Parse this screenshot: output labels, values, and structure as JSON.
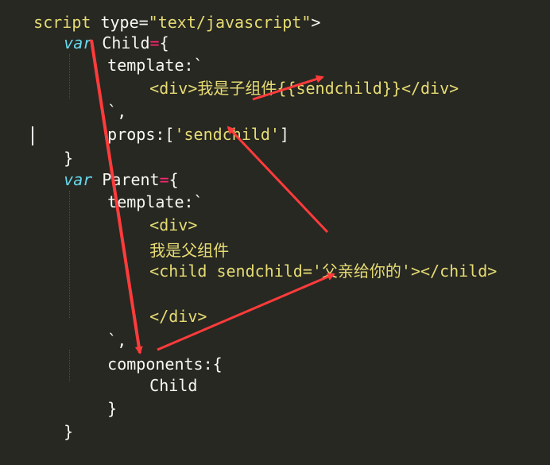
{
  "code": {
    "l0": {
      "a": "script",
      "b": " type=",
      "c": "\"text/javascript\"",
      "d": ">"
    },
    "l1": {
      "kw": "var",
      "name": " Child",
      "op": "=",
      "brace": "{"
    },
    "l2": {
      "text": "template:`"
    },
    "l3": {
      "open": "<div>",
      "cjk": "我是子组件",
      "expr": "{{sendchild}}",
      "close": "</div>"
    },
    "l4": {
      "text": "`,"
    },
    "l5": {
      "a": "props:[",
      "b": "'sendchild'",
      "c": "]"
    },
    "l6": {
      "text": "}"
    },
    "l7": {
      "kw": "var",
      "name": " Parent",
      "op": "=",
      "brace": "{"
    },
    "l8": {
      "text": "template:`"
    },
    "l9": {
      "text": "<div>"
    },
    "l10": {
      "text": "我是父组件"
    },
    "l11": {
      "a": "<child sendchild='",
      "cjk": "父亲给你的",
      "b": "'></child>"
    },
    "l12": {
      "text": "</div>"
    },
    "l13": {
      "text": "`,"
    },
    "l14": {
      "text": "components:{"
    },
    "l15": {
      "text": "Child"
    },
    "l16": {
      "text": "}"
    },
    "l17": {
      "text": "}"
    }
  },
  "colors": {
    "background": "#272822",
    "keyword": "#66d9ef",
    "operator": "#f92672",
    "string": "#e6db74",
    "text": "#f8f8f2",
    "arrow": "#ff3b3b"
  }
}
